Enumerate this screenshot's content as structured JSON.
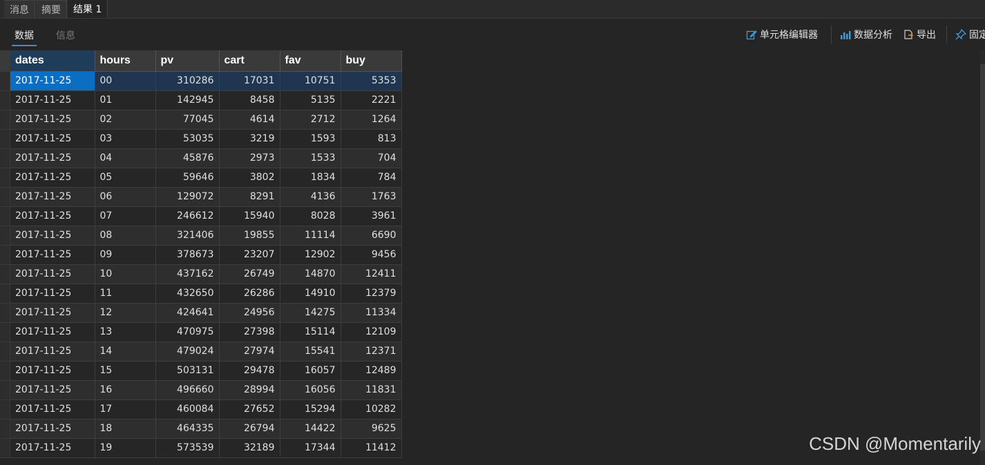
{
  "tabs": [
    {
      "label": "消息",
      "active": false
    },
    {
      "label": "摘要",
      "active": false
    },
    {
      "label": "结果 1",
      "active": true
    }
  ],
  "subtabs": {
    "data": "数据",
    "info": "信息"
  },
  "toolbar": {
    "cell_editor": "单元格编辑器",
    "data_analysis": "数据分析",
    "export": "导出",
    "pin": "固定"
  },
  "grid": {
    "columns": [
      "dates",
      "hours",
      "pv",
      "cart",
      "fav",
      "buy"
    ],
    "rows": [
      [
        "2017-11-25",
        "00",
        "310286",
        "17031",
        "10751",
        "5353"
      ],
      [
        "2017-11-25",
        "01",
        "142945",
        "8458",
        "5135",
        "2221"
      ],
      [
        "2017-11-25",
        "02",
        "77045",
        "4614",
        "2712",
        "1264"
      ],
      [
        "2017-11-25",
        "03",
        "53035",
        "3219",
        "1593",
        "813"
      ],
      [
        "2017-11-25",
        "04",
        "45876",
        "2973",
        "1533",
        "704"
      ],
      [
        "2017-11-25",
        "05",
        "59646",
        "3802",
        "1834",
        "784"
      ],
      [
        "2017-11-25",
        "06",
        "129072",
        "8291",
        "4136",
        "1763"
      ],
      [
        "2017-11-25",
        "07",
        "246612",
        "15940",
        "8028",
        "3961"
      ],
      [
        "2017-11-25",
        "08",
        "321406",
        "19855",
        "11114",
        "6690"
      ],
      [
        "2017-11-25",
        "09",
        "378673",
        "23207",
        "12902",
        "9456"
      ],
      [
        "2017-11-25",
        "10",
        "437162",
        "26749",
        "14870",
        "12411"
      ],
      [
        "2017-11-25",
        "11",
        "432650",
        "26286",
        "14910",
        "12379"
      ],
      [
        "2017-11-25",
        "12",
        "424641",
        "24956",
        "14275",
        "11334"
      ],
      [
        "2017-11-25",
        "13",
        "470975",
        "27398",
        "15114",
        "12109"
      ],
      [
        "2017-11-25",
        "14",
        "479024",
        "27974",
        "15541",
        "12371"
      ],
      [
        "2017-11-25",
        "15",
        "503131",
        "29478",
        "16057",
        "12489"
      ],
      [
        "2017-11-25",
        "16",
        "496660",
        "28994",
        "16056",
        "11831"
      ],
      [
        "2017-11-25",
        "17",
        "460084",
        "27652",
        "15294",
        "10282"
      ],
      [
        "2017-11-25",
        "18",
        "464335",
        "26794",
        "14422",
        "9625"
      ],
      [
        "2017-11-25",
        "19",
        "573539",
        "32189",
        "17344",
        "11412"
      ]
    ]
  },
  "watermark": "CSDN @Momentarily",
  "colors": {
    "accent": "#3a8fd9",
    "selected_cell": "#0a6fc2",
    "selected_row": "#203650",
    "icon_blue": "#3a9be0",
    "icon_orange": "#e0902a"
  }
}
